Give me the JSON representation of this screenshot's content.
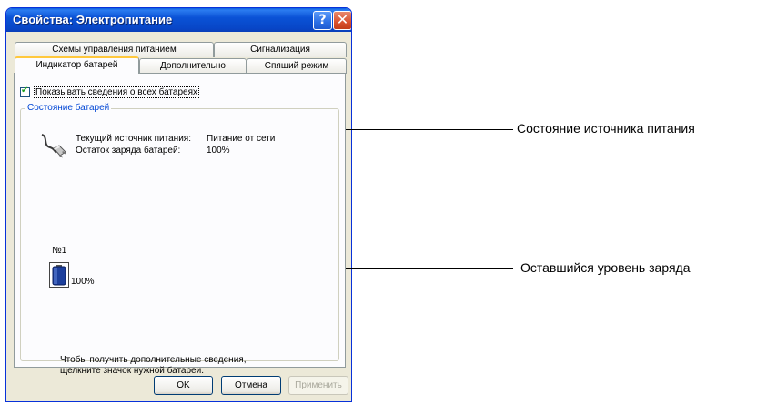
{
  "window": {
    "title": "Свойства: Электропитание"
  },
  "tabs_back": [
    {
      "label": "Схемы управления питанием"
    },
    {
      "label": "Сигнализация"
    }
  ],
  "tabs_front": [
    {
      "label": "Индикатор батарей",
      "active": true
    },
    {
      "label": "Дополнительно",
      "active": false
    },
    {
      "label": "Спящий режим",
      "active": false
    }
  ],
  "checkbox": {
    "label": "Показывать сведения о всех батареях",
    "checked": true
  },
  "group": {
    "title": "Состояние батарей",
    "power_source_label": "Текущий источник питания:",
    "power_source_value": "Питание от сети",
    "charge_label": "Остаток заряда батарей:",
    "charge_value": "100%",
    "battery_number": "№1",
    "battery_percent": "100%",
    "help_line1": "Чтобы получить дополнительные сведения,",
    "help_line2": "щелкните значок нужной батареи."
  },
  "buttons": {
    "ok": "OK",
    "cancel": "Отмена",
    "apply": "Применить"
  },
  "callouts": {
    "power_source": "Состояние источника питания",
    "charge_level": "Оставшийся уровень заряда"
  },
  "icons": {
    "help": "question-mark-icon",
    "close": "close-icon",
    "plug": "power-plug-icon",
    "battery": "battery-icon"
  },
  "colors": {
    "title_bar": "#0a52d6",
    "dialog_bg": "#ece9d8",
    "active_tab_accent": "#ffc83c",
    "group_title": "#0046d5",
    "battery_fill": "#1c3f9c"
  }
}
